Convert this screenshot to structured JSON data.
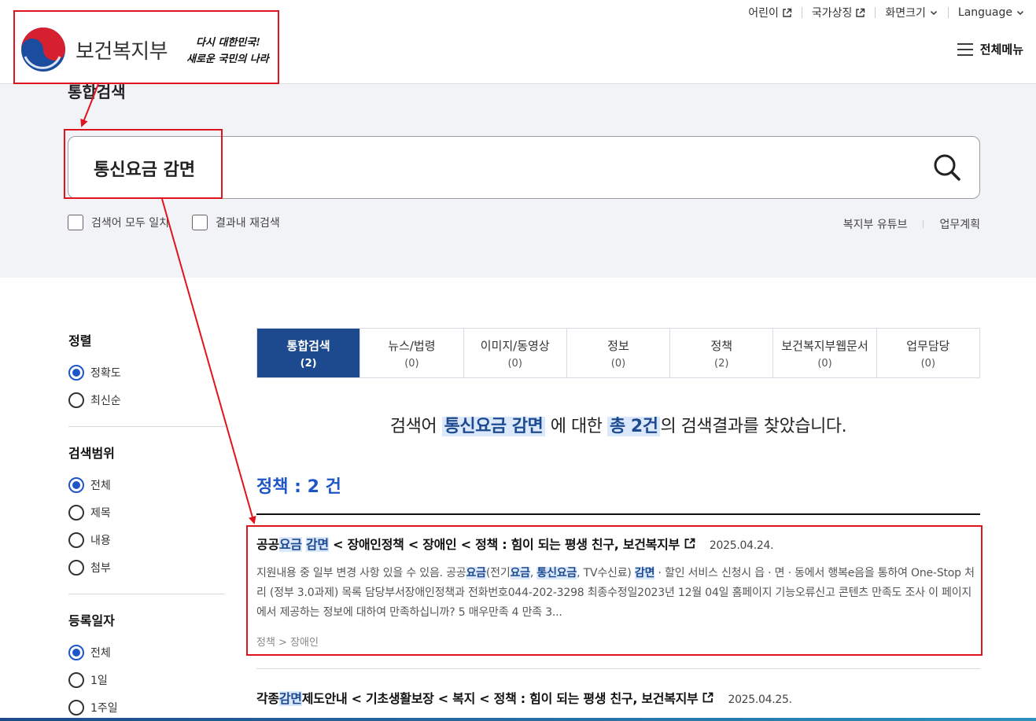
{
  "util_nav": [
    {
      "label": "어린이",
      "icon": "external-link-icon"
    },
    {
      "label": "국가상징",
      "icon": "external-link-icon"
    },
    {
      "label": "화면크기",
      "icon": "chevron-down-icon"
    },
    {
      "label": "Language",
      "icon": "chevron-down-icon"
    }
  ],
  "logo": {
    "ministry_name": "보건복지부",
    "slogan_line1": "다시 대한민국!",
    "slogan_line2": "새로운 국민의 나라"
  },
  "menu": {
    "label": "전체메뉴"
  },
  "search": {
    "page_title": "통합검색",
    "query": "통신요금 감면",
    "options": [
      "검색어 모두 일치",
      "결과내 재검색"
    ],
    "links": [
      "복지부 유튜브",
      "업무계획"
    ]
  },
  "sidebar": {
    "sort": {
      "title": "정렬",
      "options": [
        "정확도",
        "최신순"
      ],
      "selected": 0
    },
    "scope": {
      "title": "검색범위",
      "options": [
        "전체",
        "제목",
        "내용",
        "첨부"
      ],
      "selected": 0
    },
    "date": {
      "title": "등록일자",
      "options": [
        "전체",
        "1일",
        "1주일"
      ],
      "selected": 0
    }
  },
  "tabs": [
    {
      "label": "통합검색",
      "count": "(2)",
      "active": true
    },
    {
      "label": "뉴스/법령",
      "count": "(0)"
    },
    {
      "label": "이미지/동영상",
      "count": "(0)"
    },
    {
      "label": "정보",
      "count": "(0)"
    },
    {
      "label": "정책",
      "count": "(2)"
    },
    {
      "label": "보건복지부웹문서",
      "count": "(0)"
    },
    {
      "label": "업무담당",
      "count": "(0)"
    }
  ],
  "summary": {
    "prefix": "검색어",
    "query": "통신요금 감면",
    "middle": "에 대한",
    "total": "총 2건",
    "suffix": "의 검색결과를 찾았습니다."
  },
  "category_heading": "정책 : 2 건",
  "results": [
    {
      "title_parts": [
        {
          "t": "공공",
          "h": false
        },
        {
          "t": "요금",
          "h": true
        },
        {
          "t": " ",
          "h": false
        },
        {
          "t": "감면",
          "h": true
        },
        {
          "t": " < 장애인정책 < 장애인 < 정책 : 힘이 되는 평생 친구, 보건복지부",
          "h": false
        }
      ],
      "date": "2025.04.24.",
      "desc_parts": [
        {
          "t": "지원내용 중 일부 변경 사항 있을 수 있음. 공공",
          "h": false
        },
        {
          "t": "요금",
          "h": true
        },
        {
          "t": "(전기",
          "h": false
        },
        {
          "t": "요금",
          "h": true
        },
        {
          "t": ", ",
          "h": false
        },
        {
          "t": "통신요금",
          "h": true
        },
        {
          "t": ", TV수신료) ",
          "h": false
        },
        {
          "t": "감면",
          "h": true
        },
        {
          "t": " · 할인 서비스 신청시 읍 · 면 · 동에서 행복e음을 통하여 One-Stop 처리 (정부 3.0과제) 목록 담당부서장애인정책과 전화번호044-202-3298 최종수정일2023년 12월 04일 홈페이지 기능오류신고 콘텐츠 만족도 조사 이 페이지에서 제공하는 정보에 대하여 만족하십니까? 5 매우만족 4 만족 3...",
          "h": false
        }
      ],
      "path": "정책 > 장애인"
    },
    {
      "title_parts": [
        {
          "t": "각종",
          "h": false
        },
        {
          "t": "감면",
          "h": true
        },
        {
          "t": "제도안내 < 기초생활보장 < 복지 < 정책 : 힘이 되는 평생 친구, 보건복지부",
          "h": false
        }
      ],
      "date": "2025.04.25."
    }
  ],
  "colors": {
    "accent": "#1d4a8f",
    "highlight_bg": "#dbe8fb",
    "annotation": "#e0141e"
  }
}
